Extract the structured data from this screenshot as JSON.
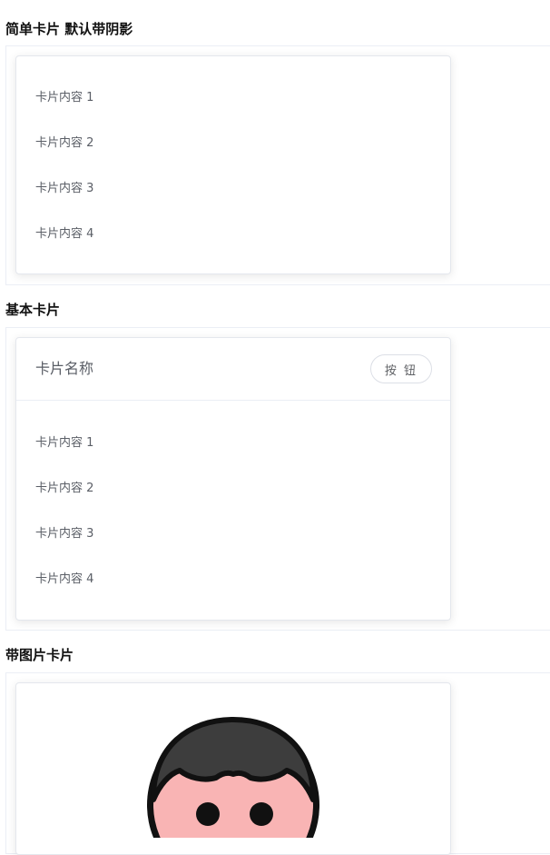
{
  "sections": [
    {
      "title": "简单卡片 默认带阴影",
      "items": [
        "卡片内容 1",
        "卡片内容 2",
        "卡片内容 3",
        "卡片内容 4"
      ]
    },
    {
      "title": "基本卡片",
      "header_title": "卡片名称",
      "header_button": "按 钮",
      "items": [
        "卡片内容 1",
        "卡片内容 2",
        "卡片内容 3",
        "卡片内容 4"
      ]
    },
    {
      "title": "带图片卡片",
      "image_icon": "avatar-illustration-icon"
    }
  ]
}
